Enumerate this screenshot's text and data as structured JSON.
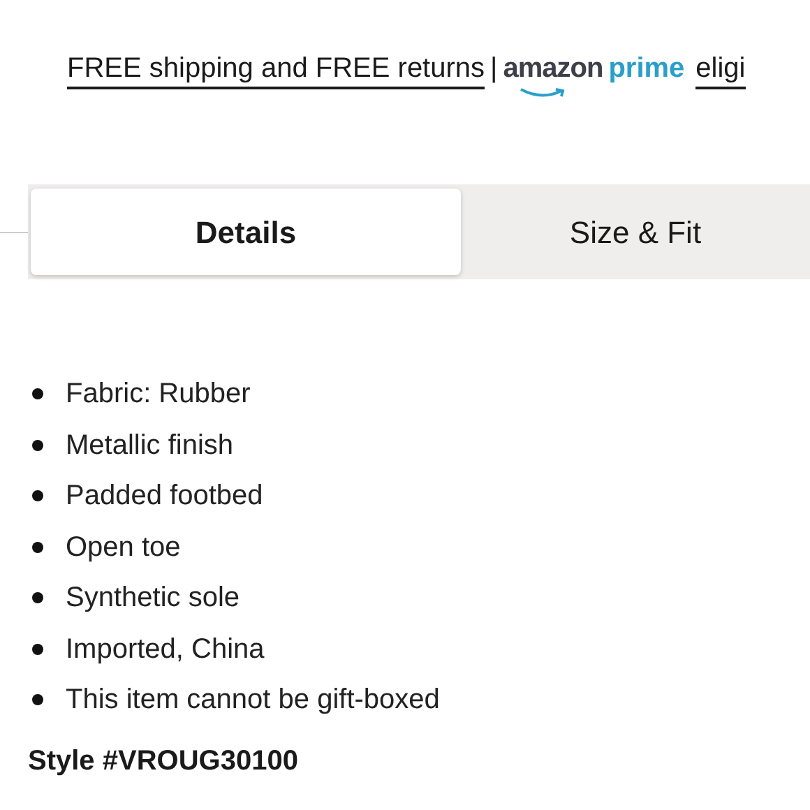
{
  "banner": {
    "shipping_link": "FREE shipping and FREE returns",
    "separator": "|",
    "logo_word": "amazon",
    "logo_prime": "prime",
    "trailing_link": "eligi"
  },
  "tabs": [
    {
      "label": "Details",
      "selected": true
    },
    {
      "label": "Size & Fit",
      "selected": false
    }
  ],
  "details": [
    "Fabric: Rubber",
    "Metallic finish",
    "Padded footbed",
    "Open toe",
    "Synthetic sole",
    "Imported, China",
    "This item cannot be gift-boxed"
  ],
  "style_number": "Style #VROUG30100"
}
